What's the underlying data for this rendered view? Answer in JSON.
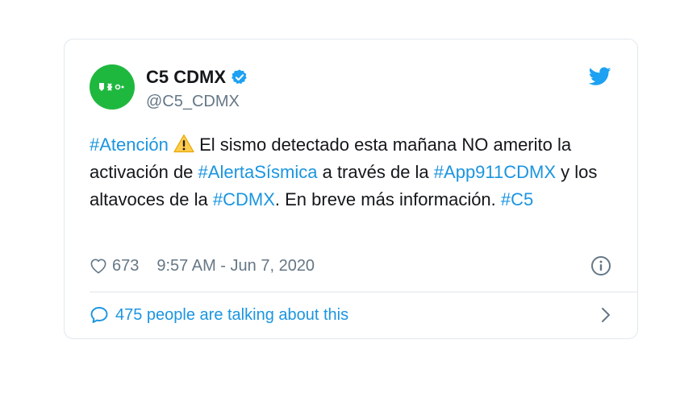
{
  "colors": {
    "link": "#1b95e0",
    "text": "#14171a",
    "secondary": "#657786",
    "avatar_bg": "#1fb83f",
    "border": "#e1e8ed"
  },
  "author": {
    "display_name": "C5 CDMX",
    "handle": "@C5_CDMX",
    "verified_icon": "verified-badge-icon",
    "avatar_icon": "c5-logo"
  },
  "tweet": {
    "tag_atencion": "#Atención",
    "text_1": " El sismo detectado esta mañana NO amerito la activación de ",
    "tag_alerta": "#AlertaSísmica",
    "text_2": " a través de la ",
    "tag_app": "#App911CDMX",
    "text_3": " y los altavoces de la ",
    "tag_cdmx": "#CDMX",
    "text_4": ". En breve más información. ",
    "tag_c5": "#C5"
  },
  "meta": {
    "likes": "673",
    "timestamp": "9:57 AM - Jun 7, 2020"
  },
  "footer": {
    "talking_label": "475 people are talking about this"
  }
}
